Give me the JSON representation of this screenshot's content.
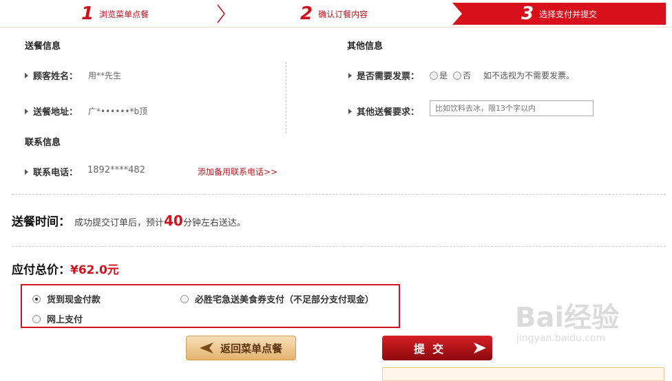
{
  "steps": [
    {
      "num": "1",
      "label": "浏览菜单点餐"
    },
    {
      "num": "2",
      "label": "确认订餐内容"
    },
    {
      "num": "3",
      "label": "选择支付并提交"
    }
  ],
  "delivery": {
    "title": "送餐信息",
    "name_label": "顾客姓名：",
    "name_value": "用**先生",
    "addr_label": "送餐地址：",
    "addr_value": "广*••••••*b顶"
  },
  "contact": {
    "title": "联系信息",
    "phone_label": "联系电话：",
    "phone_value": "1892****482",
    "add_phone_link": "添加备用联系电话>>"
  },
  "other": {
    "title": "其他信息",
    "invoice_label": "是否需要发票：",
    "invoice_yes": "是",
    "invoice_no": "否",
    "invoice_note": "如不选视为不需要发票。",
    "req_label": "其他送餐要求：",
    "req_placeholder": "比如饮料去冰，限13个字以内"
  },
  "time": {
    "label": "送餐时间：",
    "pre": "成功提交订单后，预计",
    "minutes": "40",
    "post": "分钟左右送达。"
  },
  "total": {
    "label": "应付总价：",
    "amount": "¥62.0元"
  },
  "payment": {
    "cash": "货到现金付款",
    "voucher": "必胜宅急送美食券支付（不足部分支付现金）",
    "online": "网上支付",
    "selected": "cash"
  },
  "buttons": {
    "back": "返回菜单点餐",
    "submit": "提  交"
  },
  "colors": {
    "accent": "#d7101b",
    "price": "#d0101b",
    "back_btn": "#e9bd7e"
  },
  "watermark": {
    "brand": "Bai经验",
    "url": "jingyan.baidu.com"
  }
}
